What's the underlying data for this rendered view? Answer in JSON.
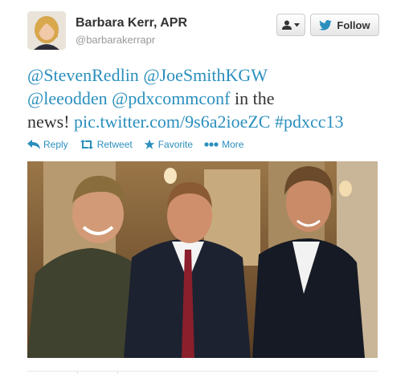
{
  "header": {
    "name": "Barbara Kerr, APR",
    "handle": "@barbarakerrapr",
    "follow_label": "Follow"
  },
  "tweet": {
    "mention1": "@StevenRedlin",
    "mention2": "@JoeSmithKGW",
    "mention3": "@leeodden",
    "mention4": "@pdxcommconf",
    "text1": " in the",
    "text2": "news! ",
    "link": "pic.twitter.com/9s6a2ioeZC",
    "hashtag": "#pdxcc13"
  },
  "actions": {
    "reply": "Reply",
    "retweet": "Retweet",
    "favorite": "Favorite",
    "more": "More"
  },
  "colors": {
    "link": "#2a8fbd",
    "name": "#333333",
    "handle": "#999999"
  },
  "icons": [
    "user-icon",
    "chevron-down-icon",
    "twitter-bird-icon",
    "reply-icon",
    "retweet-icon",
    "star-icon",
    "more-dots-icon"
  ]
}
